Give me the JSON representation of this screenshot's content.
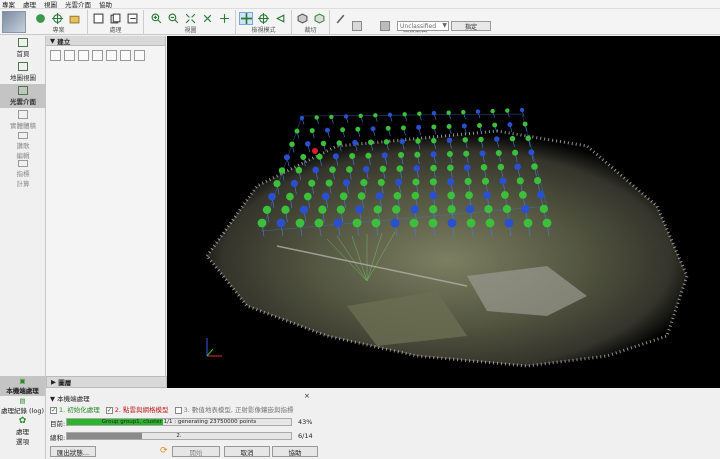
{
  "menu": [
    "專案",
    "處理",
    "視圖",
    "光雲介面",
    "協助"
  ],
  "toolbar": {
    "groups": [
      {
        "label": "專案"
      },
      {
        "label": "處理"
      },
      {
        "label": "視圖"
      },
      {
        "label": "檢視模式"
      },
      {
        "label": "裁切"
      },
      {
        "label": "點雲編輯"
      }
    ],
    "class_select": "Unclassified",
    "assign_label": "指定"
  },
  "nav": {
    "items": [
      {
        "label": "首頁",
        "icon": "home-icon"
      },
      {
        "label": "地圖視圖",
        "icon": "map-icon"
      },
      {
        "label": "光雲介面",
        "icon": "raycloud-icon",
        "active": true
      },
      {
        "label": "實體體積",
        "icon": "volume-icon"
      },
      {
        "label": "讚歌",
        "icon": "mosaic-icon"
      },
      {
        "label": "編輯",
        "icon": "edit-icon"
      },
      {
        "label": "指標",
        "icon": "index-icon"
      },
      {
        "label": "計算",
        "icon": "calc-icon"
      }
    ]
  },
  "build_panel": {
    "title": "建立"
  },
  "layers_panel": {
    "title": "圖層"
  },
  "lower_nav": [
    {
      "label": "本機端處理",
      "active": true
    },
    {
      "label": "處理紀錄 (log)"
    },
    {
      "label": "處理"
    },
    {
      "label": "選項"
    }
  ],
  "processing": {
    "title": "本機端處理",
    "close": "×",
    "steps": [
      {
        "label": "1. 初始化處理",
        "checked": true,
        "status": "done"
      },
      {
        "label": "2. 點雲與網格模型",
        "checked": true,
        "status": "running"
      },
      {
        "label": "3. 數值地表模型, 正射影像鑲嵌與指標",
        "checked": false,
        "status": "pending"
      }
    ],
    "current_label": "目前:",
    "current_text": "Group group1, cluster 1/1 : generating 23750000 points",
    "current_pct": 43,
    "current_pct_text": "43%",
    "total_label": "總和:",
    "total_text": "2.",
    "total_fraction": 0.333,
    "total_value": "6/14",
    "buttons": {
      "export": "匯出狀態...",
      "start": "開始",
      "cancel": "取消",
      "help": "協助"
    }
  }
}
